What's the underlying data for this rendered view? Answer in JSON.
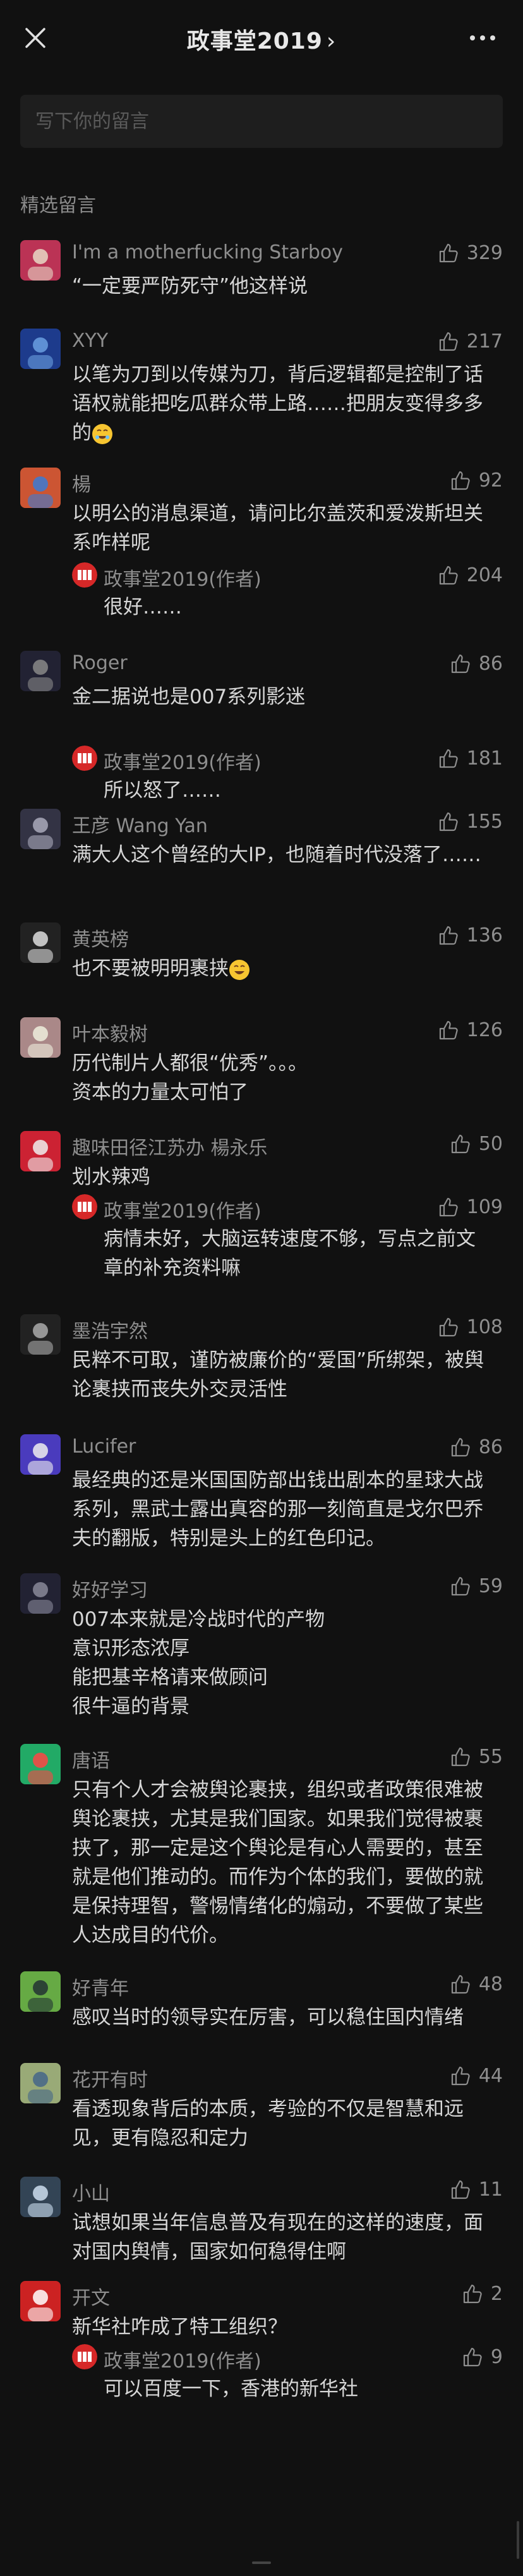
{
  "header": {
    "title": "政事堂2019",
    "chevron": "›",
    "close_icon": "close-icon",
    "more_icon": "more-icon"
  },
  "comment_input": {
    "placeholder": "写下你的留言"
  },
  "section_title": "精选留言",
  "colors": {
    "background": "#111111",
    "text": "#d6d6d6",
    "meta": "#8e8e8e",
    "author_red": "#d62828"
  },
  "comments": [
    {
      "name": "I'm a motherfucking Starboy",
      "likes": "329",
      "content": "“一定要严防死守”他这样说"
    },
    {
      "name": "XYY",
      "likes": "217",
      "content": "以笔为刀到以传媒为刀，背后逻辑都是控制了话语权就能把吃瓜群众带上路……把朋友变得多多的",
      "emoji": "😂"
    },
    {
      "name": "楊",
      "likes": "92",
      "content": "以明公的消息渠道，请问比尔盖茨和爱泼斯坦关系咋样呢",
      "reply": {
        "name": "政事堂2019(作者)",
        "likes": "204",
        "content": "很好……"
      }
    },
    {
      "name": "Roger",
      "likes": "86",
      "content": "金二据说也是007系列影迷",
      "reply": {
        "name": "政事堂2019(作者)",
        "likes": "181",
        "content": "所以怒了……"
      }
    },
    {
      "name": "王彦 Wang Yan",
      "likes": "155",
      "content": "满大人这个曾经的大IP，也随着时代没落了……"
    },
    {
      "name": "黄英榜",
      "likes": "136",
      "content": "也不要被明明裹挟",
      "emoji": "😁"
    },
    {
      "name": "叶本毅树",
      "likes": "126",
      "content": "历代制片人都很“优秀”。。。\n资本的力量太可怕了"
    },
    {
      "name": "趣味田径江苏办 楊永乐",
      "likes": "50",
      "content": "划水辣鸡",
      "reply": {
        "name": "政事堂2019(作者)",
        "likes": "109",
        "content": "病情未好，大脑运转速度不够，写点之前文章的补充资料嘛"
      }
    },
    {
      "name": "墨浩宇然",
      "likes": "108",
      "content": "民粹不可取，谨防被廉价的“爱国”所绑架，被舆论裹挟而丧失外交灵活性"
    },
    {
      "name": "Lucifer",
      "likes": "86",
      "content": "最经典的还是米国国防部出钱出剧本的星球大战系列，黑武士露出真容的那一刻简直是戈尔巴乔夫的翻版，特别是头上的红色印记。"
    },
    {
      "name": "好好学习",
      "likes": "59",
      "content": "007本来就是冷战时代的产物\n意识形态浓厚\n能把基辛格请来做顾问\n很牛逼的背景"
    },
    {
      "name": "唐语",
      "likes": "55",
      "content": "只有个人才会被舆论裹挟，组织或者政策很难被舆论裹挟，尤其是我们国家。如果我们觉得被裹挟了，那一定是这个舆论是有心人需要的，甚至就是他们推动的。而作为个体的我们，要做的就是保持理智，警惕情绪化的煽动，不要做了某些人达成目的代价。"
    },
    {
      "name": "好青年",
      "likes": "48",
      "content": "感叹当时的领导实在厉害，可以稳住国内情绪"
    },
    {
      "name": "花开有时",
      "likes": "44",
      "content": "看透现象背后的本质，考验的不仅是智慧和远见，更有隐忍和定力"
    },
    {
      "name": "小山",
      "likes": "11",
      "content": "试想如果当年信息普及有现在的这样的速度，面对国内舆情，国家如何稳得住啊"
    },
    {
      "name": "开文",
      "likes": "2",
      "content": "新华社咋成了特工组织？",
      "reply": {
        "name": "政事堂2019(作者)",
        "likes": "9",
        "content": "可以百度一下，香港的新华社"
      }
    }
  ]
}
